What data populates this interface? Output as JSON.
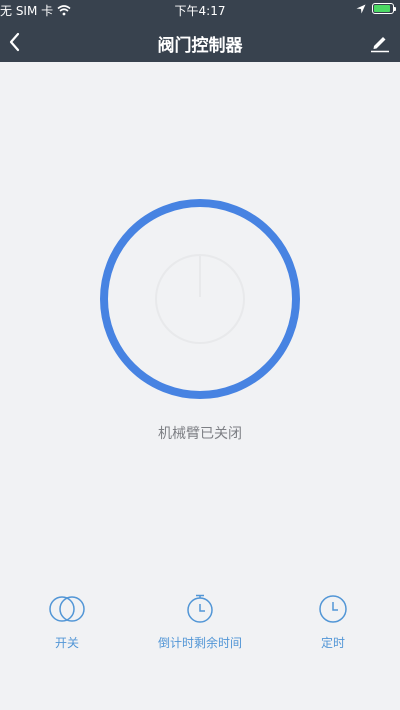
{
  "status_bar": {
    "carrier": "无 SIM 卡",
    "time": "下午4:17",
    "battery_level": 0.9
  },
  "nav": {
    "title": "阀门控制器",
    "back_icon": "chevron-left-icon",
    "edit_icon": "pencil-icon"
  },
  "device": {
    "status": "机械臂已关闭",
    "power_icon": "power-icon"
  },
  "actions": [
    {
      "label": "开关",
      "icon": "toggle-icon"
    },
    {
      "label": "倒计时剩余时间",
      "icon": "stopwatch-icon"
    },
    {
      "label": "定时",
      "icon": "clock-icon"
    }
  ],
  "colors": {
    "header_bg": "#38424e",
    "page_bg": "#f1f2f4",
    "accent": "#4783e2",
    "action_text": "#5296d6",
    "battery": "#4cd964"
  }
}
